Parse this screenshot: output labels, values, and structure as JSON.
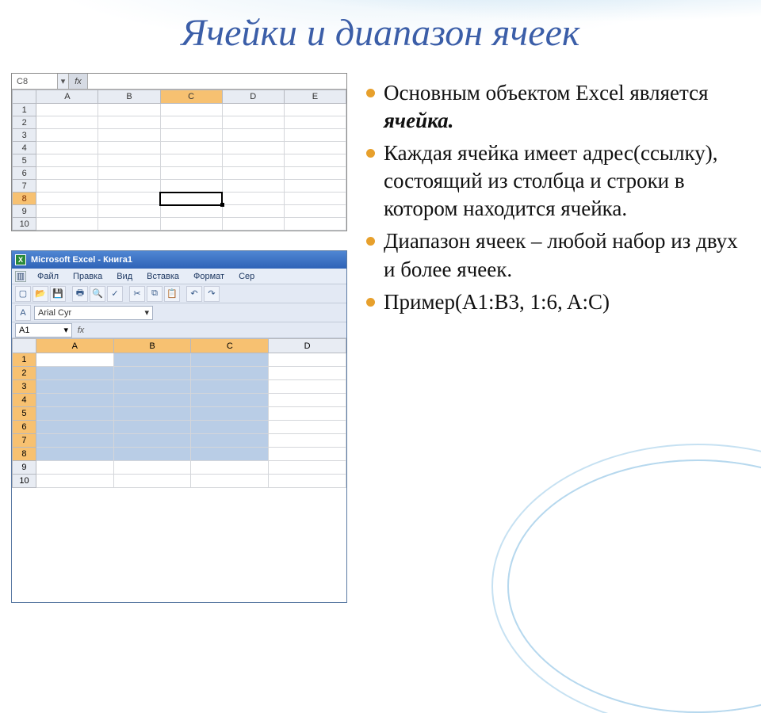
{
  "title": "Ячейки и диапазон ячеек",
  "bullets": {
    "b1_pre": "Основным объектом Excel является ",
    "b1_em": "ячейка.",
    "b2": "Каждая ячейка имеет адрес(ссылку), состоящий из столбца и строки в котором находится ячейка.",
    "b3": "Диапазон ячеек – любой набор из двух и более ячеек.",
    "b4": "Пример(A1:B3, 1:6, A:C)"
  },
  "xl1": {
    "namebox": "C8",
    "fx": "fx",
    "cols": [
      "A",
      "B",
      "C",
      "D",
      "E"
    ],
    "selected_col": "C",
    "selected_row": "8",
    "rows": [
      "1",
      "2",
      "3",
      "4",
      "5",
      "6",
      "7",
      "8",
      "9",
      "10"
    ],
    "active_cell": "C8"
  },
  "xl2": {
    "window_title": "Microsoft Excel - Книга1",
    "menu": {
      "file": "Файл",
      "edit": "Правка",
      "view": "Вид",
      "insert": "Вставка",
      "format": "Формат",
      "service": "Сер"
    },
    "font": "Arial Cyr",
    "namebox": "A1",
    "fx": "fx",
    "cols": [
      "A",
      "B",
      "C",
      "D"
    ],
    "selected_cols": [
      "A",
      "B",
      "C"
    ],
    "rows": [
      "1",
      "2",
      "3",
      "4",
      "5",
      "6",
      "7",
      "8",
      "9",
      "10"
    ],
    "selected_rows": [
      "1",
      "2",
      "3",
      "4",
      "5",
      "6",
      "7",
      "8"
    ],
    "selection": "A1:C8"
  }
}
